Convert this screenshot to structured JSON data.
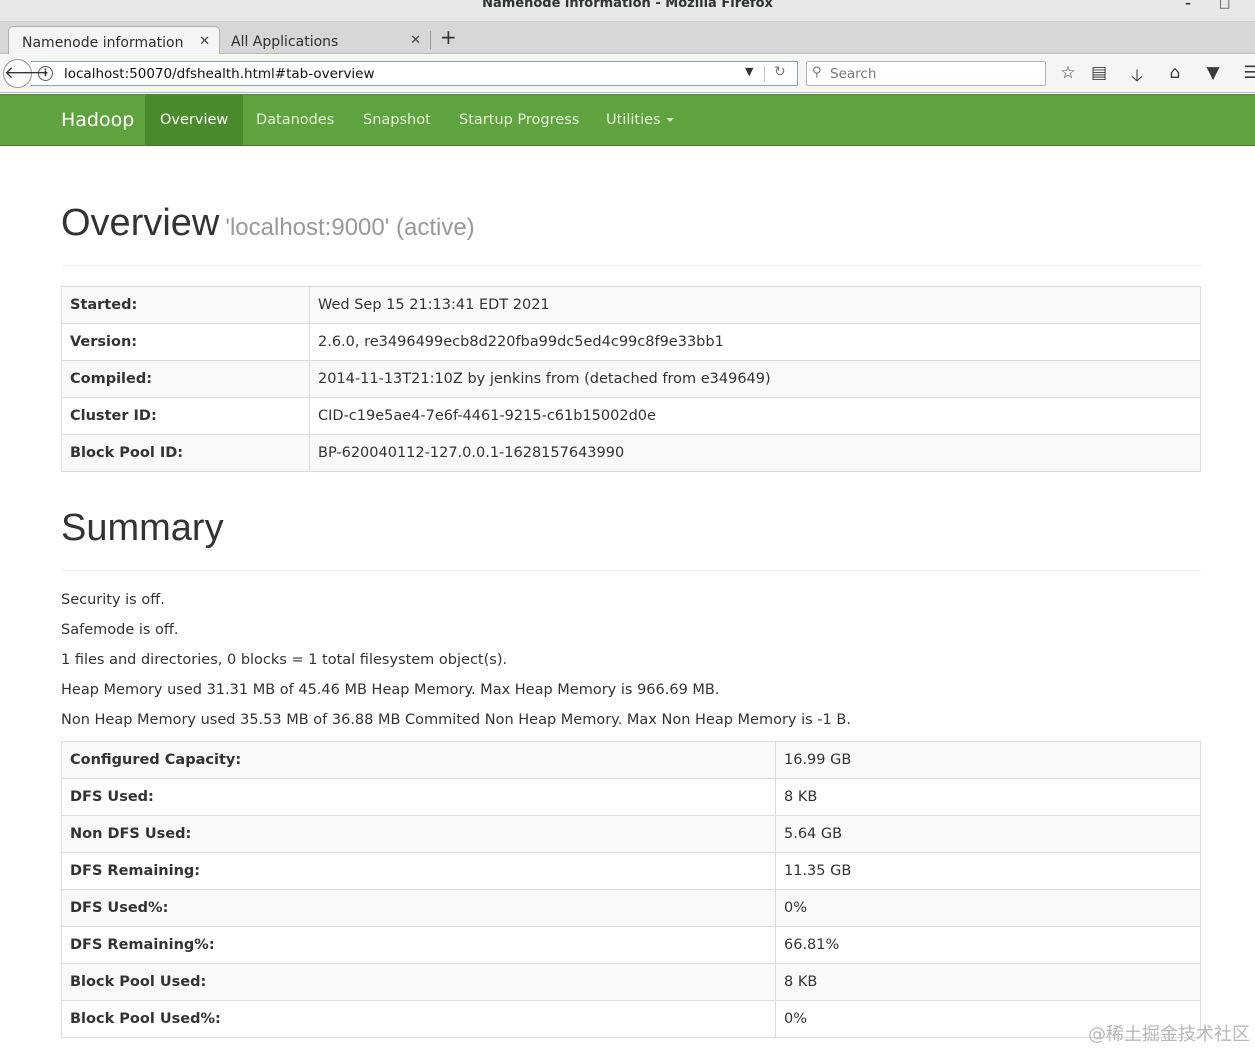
{
  "window": {
    "title": "Namenode information - Mozilla Firefox"
  },
  "tabs": [
    {
      "label": "Namenode information"
    },
    {
      "label": "All Applications"
    }
  ],
  "address_bar": {
    "url": "localhost:50070/dfshealth.html#tab-overview"
  },
  "search": {
    "placeholder": "Search"
  },
  "hadoop_nav": {
    "brand": "Hadoop",
    "items": [
      {
        "label": "Overview"
      },
      {
        "label": "Datanodes"
      },
      {
        "label": "Snapshot"
      },
      {
        "label": "Startup Progress"
      },
      {
        "label": "Utilities"
      }
    ]
  },
  "overview": {
    "title": "Overview",
    "subtitle": "'localhost:9000' (active)",
    "rows": [
      {
        "key": "Started:",
        "value": "Wed Sep 15 21:13:41 EDT 2021"
      },
      {
        "key": "Version:",
        "value": "2.6.0, re3496499ecb8d220fba99dc5ed4c99c8f9e33bb1"
      },
      {
        "key": "Compiled:",
        "value": "2014-11-13T21:10Z by jenkins from (detached from e349649)"
      },
      {
        "key": "Cluster ID:",
        "value": "CID-c19e5ae4-7e6f-4461-9215-c61b15002d0e"
      },
      {
        "key": "Block Pool ID:",
        "value": "BP-620040112-127.0.0.1-1628157643990"
      }
    ]
  },
  "summary": {
    "title": "Summary",
    "lines": [
      "Security is off.",
      "Safemode is off.",
      "1 files and directories, 0 blocks = 1 total filesystem object(s).",
      "Heap Memory used 31.31 MB of 45.46 MB Heap Memory. Max Heap Memory is 966.69 MB.",
      "Non Heap Memory used 35.53 MB of 36.88 MB Commited Non Heap Memory. Max Non Heap Memory is -1 B."
    ],
    "rows": [
      {
        "key": "Configured Capacity:",
        "value": "16.99 GB"
      },
      {
        "key": "DFS Used:",
        "value": "8 KB"
      },
      {
        "key": "Non DFS Used:",
        "value": "5.64 GB"
      },
      {
        "key": "DFS Remaining:",
        "value": "11.35 GB"
      },
      {
        "key": "DFS Used%:",
        "value": "0%"
      },
      {
        "key": "DFS Remaining%:",
        "value": "66.81%"
      },
      {
        "key": "Block Pool Used:",
        "value": "8 KB"
      },
      {
        "key": "Block Pool Used%:",
        "value": "0%"
      }
    ]
  },
  "watermark": "@稀土掘金技术社区",
  "colors": {
    "hadoop_green": "#5fa33e",
    "active_tab_green": "#4a8c2b"
  }
}
